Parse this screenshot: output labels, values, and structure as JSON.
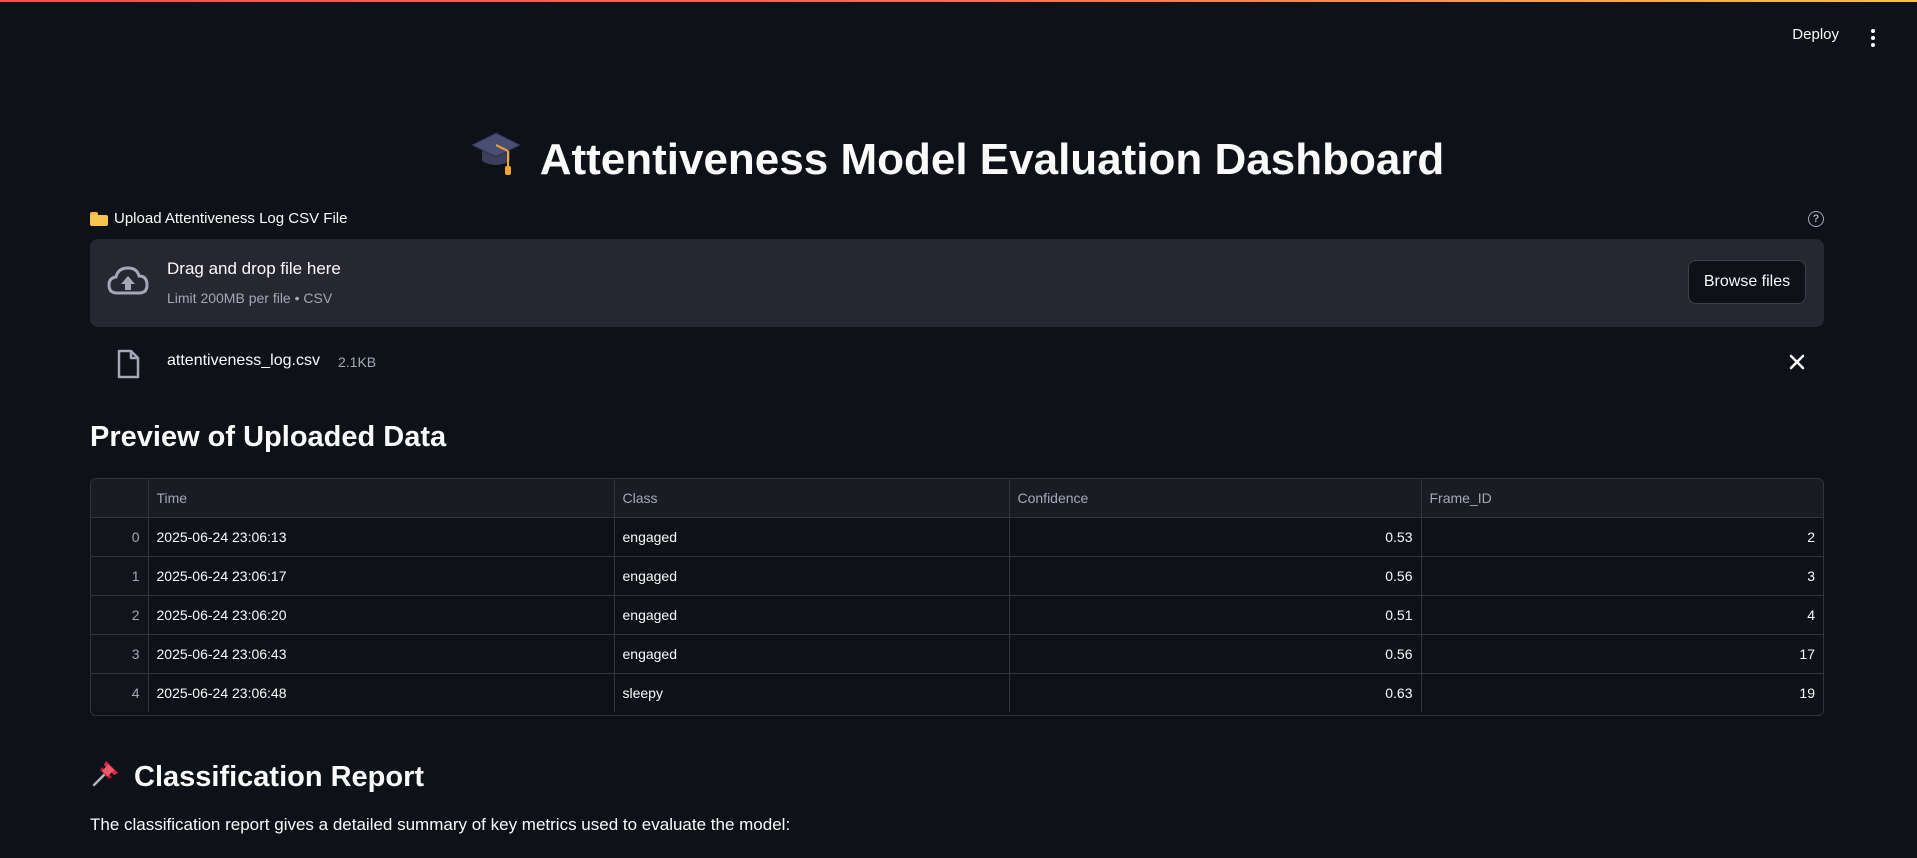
{
  "header": {
    "deploy_label": "Deploy",
    "menu_icon": "kebab-menu-icon"
  },
  "title": {
    "emoji_icon": "graduation-cap-icon",
    "text": "Attentiveness Model Evaluation Dashboard"
  },
  "uploader": {
    "label": "Upload Attentiveness Log CSV File",
    "label_icon": "folder-icon",
    "drop_text": "Drag and drop file here",
    "limit_text": "Limit 200MB per file • CSV",
    "browse_label": "Browse files",
    "file": {
      "name": "attentiveness_log.csv",
      "size": "2.1KB"
    }
  },
  "preview": {
    "heading": "Preview of Uploaded Data",
    "columns": [
      "",
      "Time",
      "Class",
      "Confidence",
      "Frame_ID"
    ],
    "rows": [
      {
        "idx": "0",
        "time": "2025-06-24 23:06:13",
        "class": "engaged",
        "confidence": "0.53",
        "frame_id": "2"
      },
      {
        "idx": "1",
        "time": "2025-06-24 23:06:17",
        "class": "engaged",
        "confidence": "0.56",
        "frame_id": "3"
      },
      {
        "idx": "2",
        "time": "2025-06-24 23:06:20",
        "class": "engaged",
        "confidence": "0.51",
        "frame_id": "4"
      },
      {
        "idx": "3",
        "time": "2025-06-24 23:06:43",
        "class": "engaged",
        "confidence": "0.56",
        "frame_id": "17"
      },
      {
        "idx": "4",
        "time": "2025-06-24 23:06:48",
        "class": "sleepy",
        "confidence": "0.63",
        "frame_id": "19"
      }
    ]
  },
  "report": {
    "heading_icon": "pushpin-icon",
    "heading": "Classification Report",
    "description": "The classification report gives a detailed summary of key metrics used to evaluate the model:"
  },
  "colors": {
    "background": "#0e1117",
    "dropzone": "#262730",
    "accent": "#ff4b4b"
  }
}
